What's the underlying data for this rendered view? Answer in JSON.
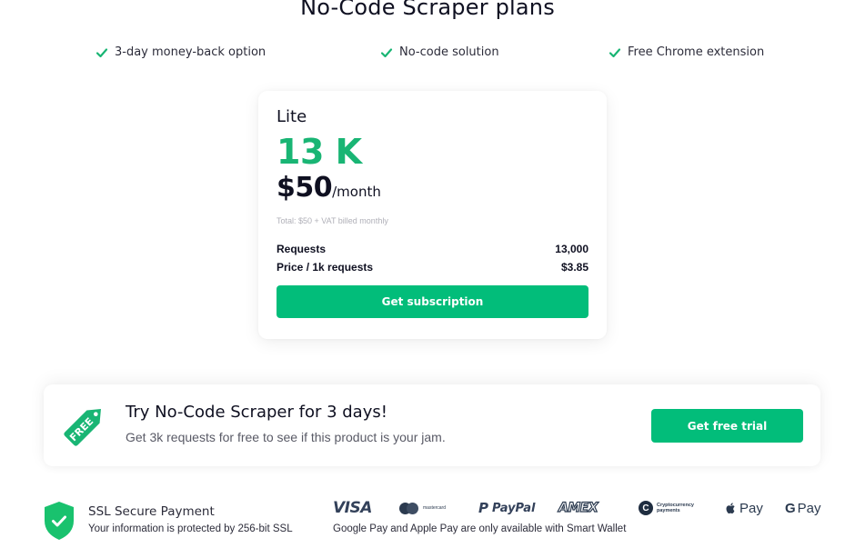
{
  "header": {
    "title": "No-Code Scraper plans"
  },
  "features": [
    {
      "icon": "check-icon",
      "label": "3-day money-back option"
    },
    {
      "icon": "check-icon",
      "label": "No-code solution"
    },
    {
      "icon": "check-icon",
      "label": "Free Chrome extension"
    }
  ],
  "plan": {
    "name": "Lite",
    "amount": "13 K",
    "price": "$50",
    "period": "/month",
    "total_note": "Total: $50 + VAT billed monthly",
    "rows": [
      {
        "label": "Requests",
        "value": "13,000"
      },
      {
        "label": "Price / 1k requests",
        "value": "$3.85"
      }
    ],
    "button_label": "Get subscription"
  },
  "trial": {
    "badge_text": "FREE",
    "title": "Try No-Code Scraper for 3 days!",
    "subtitle": "Get 3k requests for free to see if this product is your jam.",
    "button_label": "Get free trial"
  },
  "security": {
    "title": "SSL Secure Payment",
    "subtitle": "Your information is protected by 256-bit SSL"
  },
  "payments": {
    "visa": "VISA",
    "mastercard": "mastercard",
    "paypal": "PayPal",
    "amex": "AMEX",
    "crypto_line1": "Cryptocurrency",
    "crypto_line2": "payments",
    "apple_pay": "Pay",
    "google_pay": "Pay",
    "note": "Google Pay and Apple Pay are only available with Smart Wallet"
  },
  "colors": {
    "accent": "#02bd7a",
    "amount_green": "#19b574",
    "text_dark": "#0f1021"
  }
}
